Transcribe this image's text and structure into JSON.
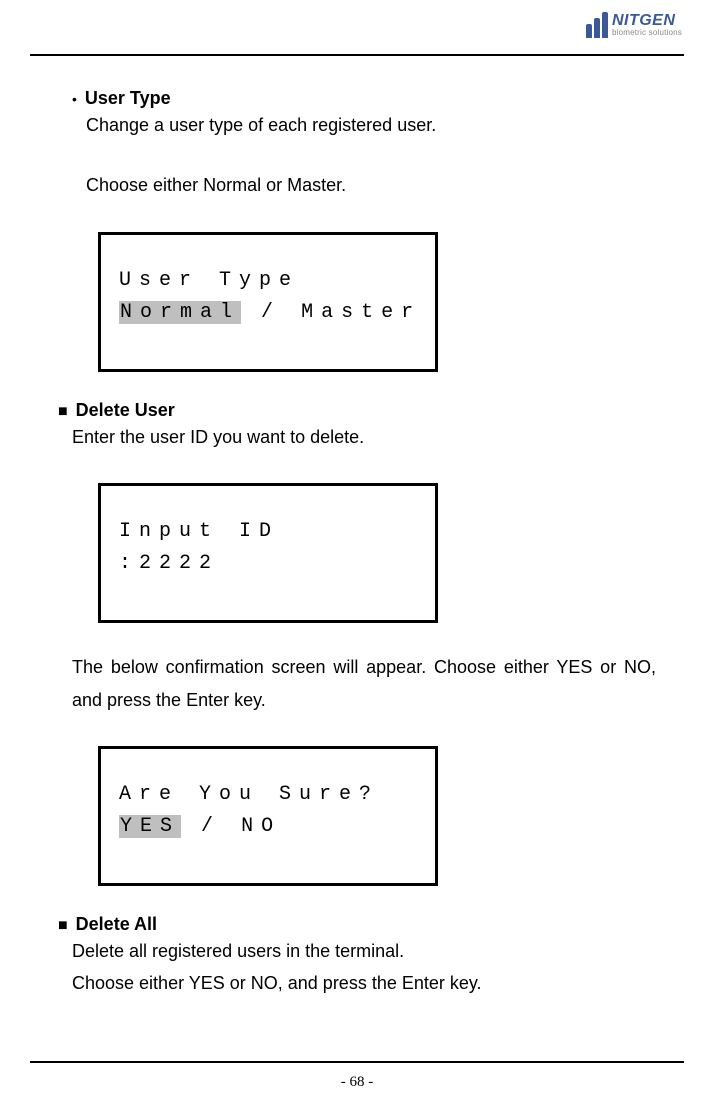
{
  "brand": {
    "name": "NITGEN",
    "tagline": "biometric solutions"
  },
  "section1": {
    "title": "User Type",
    "line1": "Change a user type of each registered user.",
    "line2": "Choose either Normal or Master.",
    "lcd": {
      "row1": "User Type",
      "highlight": "Normal",
      "sep": "/",
      "alt": "Master"
    }
  },
  "section2": {
    "title": "Delete User",
    "line1": "Enter the user ID you want to delete.",
    "lcd1": {
      "row1": "Input ID",
      "row2": ":2222"
    },
    "line2": "The below confirmation screen will appear. Choose either YES or NO, and press the Enter key.",
    "lcd2": {
      "row1": "Are You Sure?",
      "highlight": "YES",
      "sep": "/",
      "alt": "NO"
    }
  },
  "section3": {
    "title": "Delete All",
    "line1": "Delete all registered users in the terminal.",
    "line2": "Choose either YES or NO, and press the Enter key."
  },
  "pageNumber": "- 68 -"
}
